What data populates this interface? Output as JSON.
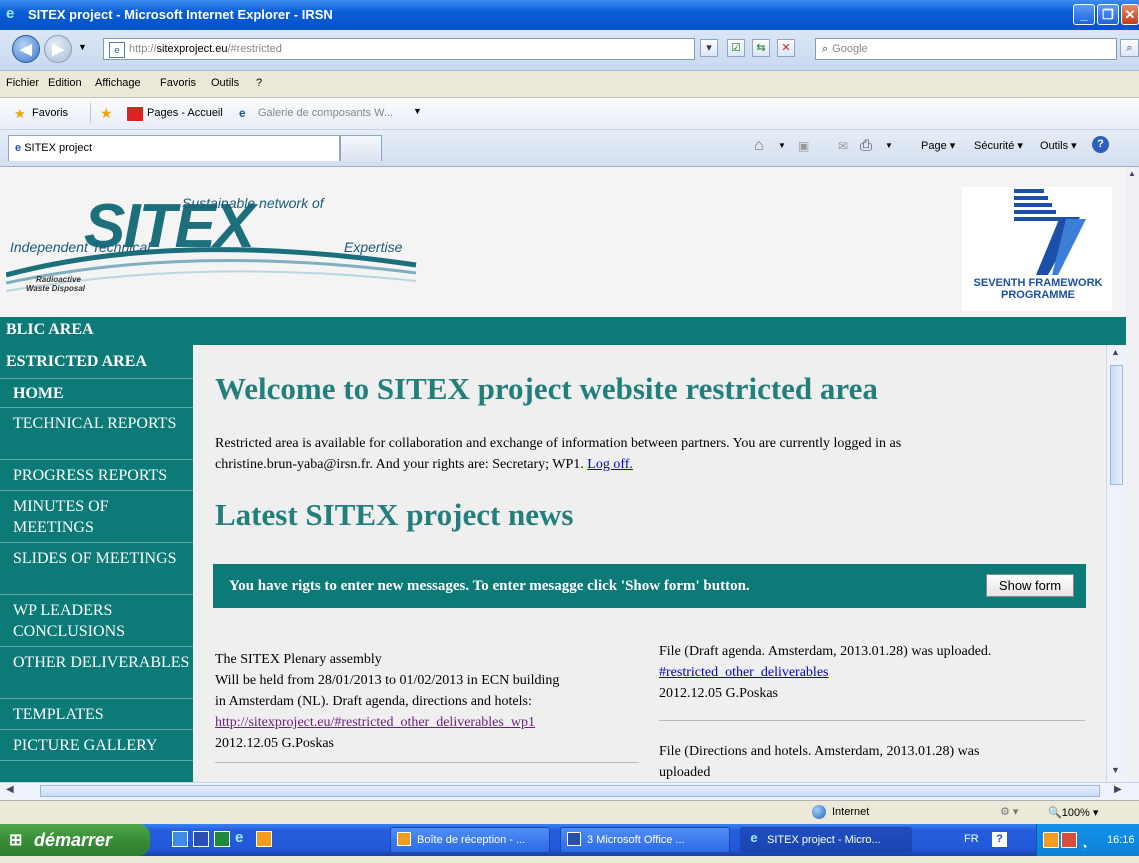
{
  "window": {
    "title": "SITEX project - Microsoft Internet Explorer - IRSN"
  },
  "address": {
    "url_prefix": "http://",
    "url_domain": "sitexproject.eu",
    "url_suffix": "/#restricted",
    "search_placeholder": "Google"
  },
  "menu": [
    "Fichier",
    "Edition",
    "Affichage",
    "Favoris",
    "Outils",
    "?"
  ],
  "favorites": {
    "label": "Favoris",
    "items": [
      "Pages - Accueil",
      "Galerie de composants W..."
    ]
  },
  "tab": {
    "title": "SITEX project"
  },
  "commands": [
    "Page",
    "Sécurité",
    "Outils"
  ],
  "header": {
    "logo": {
      "main": "SITEX",
      "tagline_top": "Sustainable network of",
      "tagline_left": "Independent Technical",
      "tagline_right": "Expertise",
      "sub1": "Radioactive",
      "sub2": "Waste Disposal"
    },
    "fp7": {
      "line1": "SEVENTH FRAMEWORK",
      "line2": "PROGRAMME"
    }
  },
  "sidebar": {
    "public": "BLIC AREA",
    "restricted": "ESTRICTED AREA",
    "items": [
      {
        "label": "HOME"
      },
      {
        "label": "TECHNICAL REPORTS"
      },
      {
        "label": "PROGRESS REPORTS"
      },
      {
        "label": "MINUTES OF MEETINGS"
      },
      {
        "label": "SLIDES OF MEETINGS"
      },
      {
        "label": "WP LEADERS CONCLUSIONS"
      },
      {
        "label": "OTHER DELIVERABLES"
      },
      {
        "label": "TEMPLATES"
      },
      {
        "label": "PICTURE GALLERY"
      }
    ]
  },
  "content": {
    "welcome": "Welcome to SITEX project website restricted area",
    "intro_1": "Restricted area is available for collaboration and exchange of information between partners. You are currently logged in as",
    "intro_2": "christine.brun-yaba@irsn.fr. And your rights are: Secretary; WP1.",
    "logoff": "Log off.",
    "news_title": "Latest SITEX project news",
    "message_bar": "You have rigts to enter new messages. To enter mesagge click 'Show form' button.",
    "show_form": "Show form",
    "news_left": {
      "l1": "The SITEX Plenary assembly",
      "l2": "Will be held from 28/01/2013 to 01/02/2013 in ECN building",
      "l3": "in Amsterdam (NL). Draft agenda, directions and hotels:",
      "link": "http://sitexproject.eu/#restricted_other_deliverables_wp1",
      "meta": "2012.12.05 G.Poskas"
    },
    "news_right1": {
      "l1": "File (Draft agenda. Amsterdam, 2013.01.28) was uploaded.",
      "link": "#restricted_other_deliverables",
      "meta": "2012.12.05 G.Poskas"
    },
    "news_right2": {
      "l1": "File (Directions and hotels. Amsterdam, 2013.01.28) was",
      "l2": "uploaded"
    }
  },
  "status": {
    "zone": "Internet",
    "zoom": "100%"
  },
  "taskbar": {
    "start": "démarrer",
    "tasks": [
      "Boîte de réception - ...",
      "3 Microsoft Office ...",
      "SITEX project - Micro..."
    ],
    "lang": "FR",
    "time": "16:16"
  }
}
